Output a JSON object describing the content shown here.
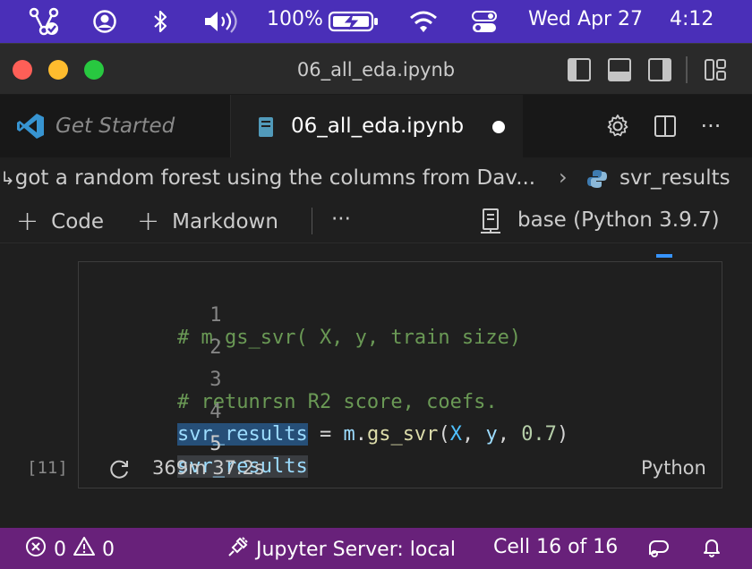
{
  "menubar": {
    "battery_percent": "100%",
    "date": "Wed Apr 27",
    "time": "4:12"
  },
  "window": {
    "title": "06_all_eda.ipynb"
  },
  "tabs": [
    {
      "label": "Get Started"
    },
    {
      "label": "06_all_eda.ipynb"
    }
  ],
  "breadcrumb": {
    "section": "got a random forest using the columns from Dav...",
    "symbol": "svr_results"
  },
  "toolbar": {
    "code_label": "Code",
    "markdown_label": "Markdown",
    "more_label": "···",
    "kernel_label": "base (Python 3.9.7)"
  },
  "cell": {
    "lines": [
      {
        "num": "1",
        "text": "# m.gs_svr( X, y, train size)"
      },
      {
        "num": "2",
        "text": ""
      },
      {
        "num": "3",
        "text": "# retunrsn R2 score, coefs."
      },
      {
        "num": "4",
        "v1": "svr_results",
        "eq": " = ",
        "mod": "m",
        "dot": ".",
        "fn": "gs_svr",
        "open": "(",
        "a1": "X",
        "c1": ", ",
        "a2": "y",
        "c2": ", ",
        "n": "0.7",
        "close": ")"
      },
      {
        "num": "5",
        "text": "svr_results"
      }
    ],
    "execution_count": "[11]",
    "duration": "369m 37.2s",
    "language": "Python"
  },
  "statusbar": {
    "errors": "0",
    "warnings": "0",
    "server": "Jupyter Server: local",
    "cell_position": "Cell 16 of 16"
  }
}
